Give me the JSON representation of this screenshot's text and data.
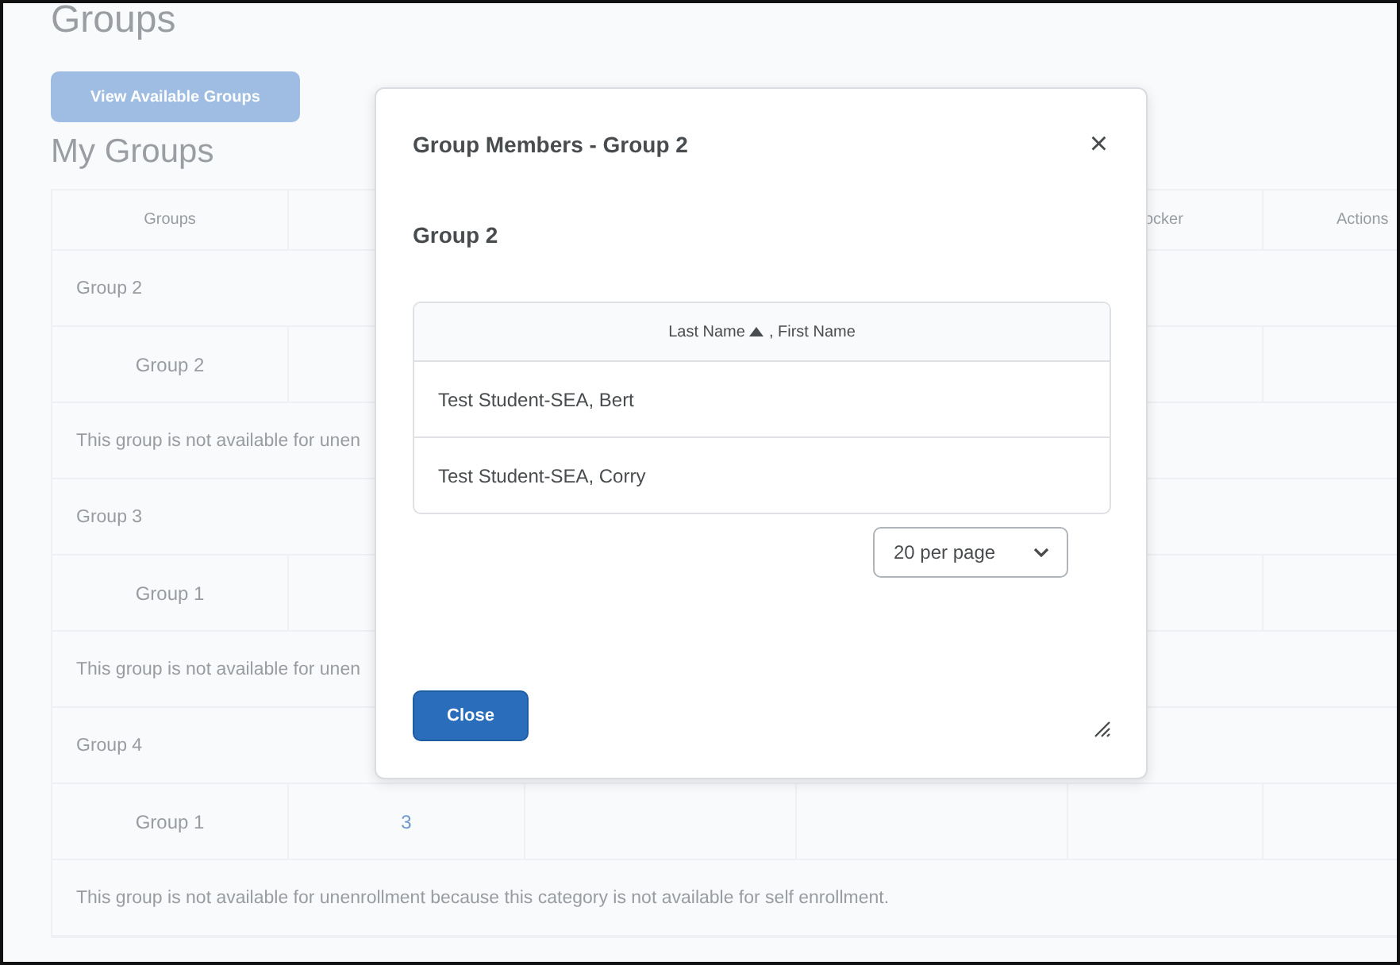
{
  "page": {
    "title": "Groups",
    "view_button": "View Available Groups",
    "section_title": "My Groups",
    "table": {
      "columns": [
        "Groups",
        "",
        "",
        "",
        "ocker",
        "Actions"
      ],
      "sections": [
        {
          "category": "Group 2",
          "rows": [
            {
              "group": "Group 2",
              "members": ""
            }
          ],
          "notice": "This group is not available for unen"
        },
        {
          "category": "Group 3",
          "rows": [
            {
              "group": "Group 1",
              "members": ""
            }
          ],
          "notice": "This group is not available for unen"
        },
        {
          "category": "Group 4",
          "rows": [
            {
              "group": "Group 1",
              "members": "3"
            }
          ],
          "notice": "This group is not available for unenrollment because this category is not available for self enrollment."
        }
      ]
    }
  },
  "dialog": {
    "title": "Group Members - Group 2",
    "close_symbol": "×",
    "group_name": "Group 2",
    "table": {
      "header_primary": "Last Name",
      "header_secondary": ", First Name",
      "rows": [
        "Test Student-SEA, Bert",
        "Test Student-SEA, Corry"
      ]
    },
    "page_size": "20 per page",
    "close_button": "Close"
  }
}
